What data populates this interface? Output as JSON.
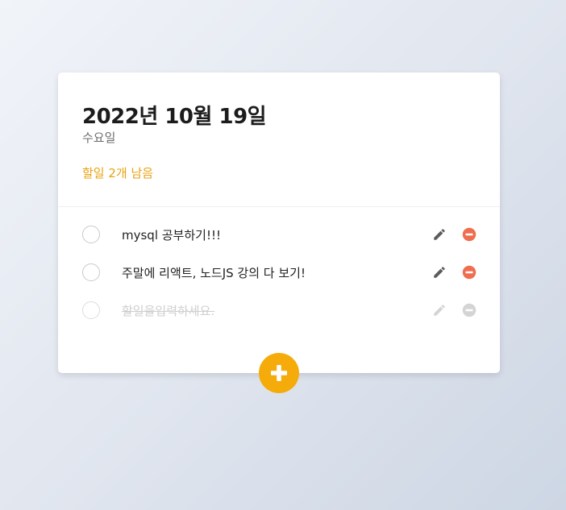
{
  "header": {
    "date": "2022년 10월 19일",
    "weekday": "수요일",
    "remaining": "할일 2개 남음"
  },
  "todos": [
    {
      "text": "mysql 공부하기!!!",
      "done": false
    },
    {
      "text": "주말에 리액트, 노드JS 강의 다 보기!",
      "done": false
    },
    {
      "text": "할일을입력하세요.",
      "done": false,
      "placeholder": true
    }
  ],
  "colors": {
    "accent": "#f5ac0a",
    "remaining_text": "#e8a20f",
    "delete": "#ef6e50",
    "edit": "#5c5c5c",
    "disabled": "#cfcfcf"
  },
  "icons": {
    "edit": "pencil-icon",
    "delete": "minus-circle-icon",
    "add": "plus-icon"
  }
}
